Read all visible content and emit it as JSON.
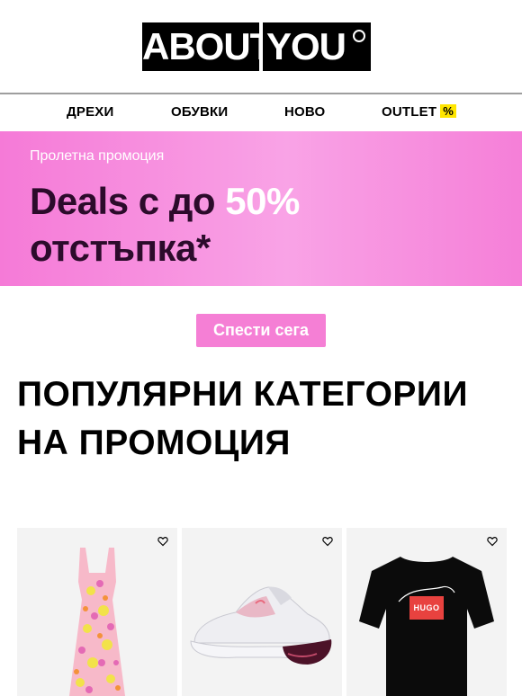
{
  "header": {
    "logo_part1": "ABOUT",
    "logo_part2": "YOU"
  },
  "nav": {
    "items": [
      {
        "label": "ДРЕХИ"
      },
      {
        "label": "ОБУВКИ"
      },
      {
        "label": "НОВО"
      },
      {
        "label": "OUTLET",
        "badge": "%"
      }
    ]
  },
  "banner": {
    "eyebrow": "Пролетна промоция",
    "headline_part1": "Deals с до ",
    "headline_highlight": "50%",
    "headline_part2": "отстъпка*"
  },
  "cta": {
    "label": "Спести сега"
  },
  "section": {
    "title": "ПОПУЛЯРНИ КАТЕГОРИИ НА ПРОМОЦИЯ"
  },
  "products": [
    {
      "name": "dress",
      "icon": "heart-icon"
    },
    {
      "name": "sneaker",
      "icon": "heart-icon"
    },
    {
      "name": "t-shirt",
      "icon": "heart-icon",
      "print_text": "HUGO"
    }
  ],
  "colors": {
    "accent_pink": "#f57fd5",
    "banner_text": "#2c0b2b",
    "outlet_badge": "#ffe600"
  }
}
